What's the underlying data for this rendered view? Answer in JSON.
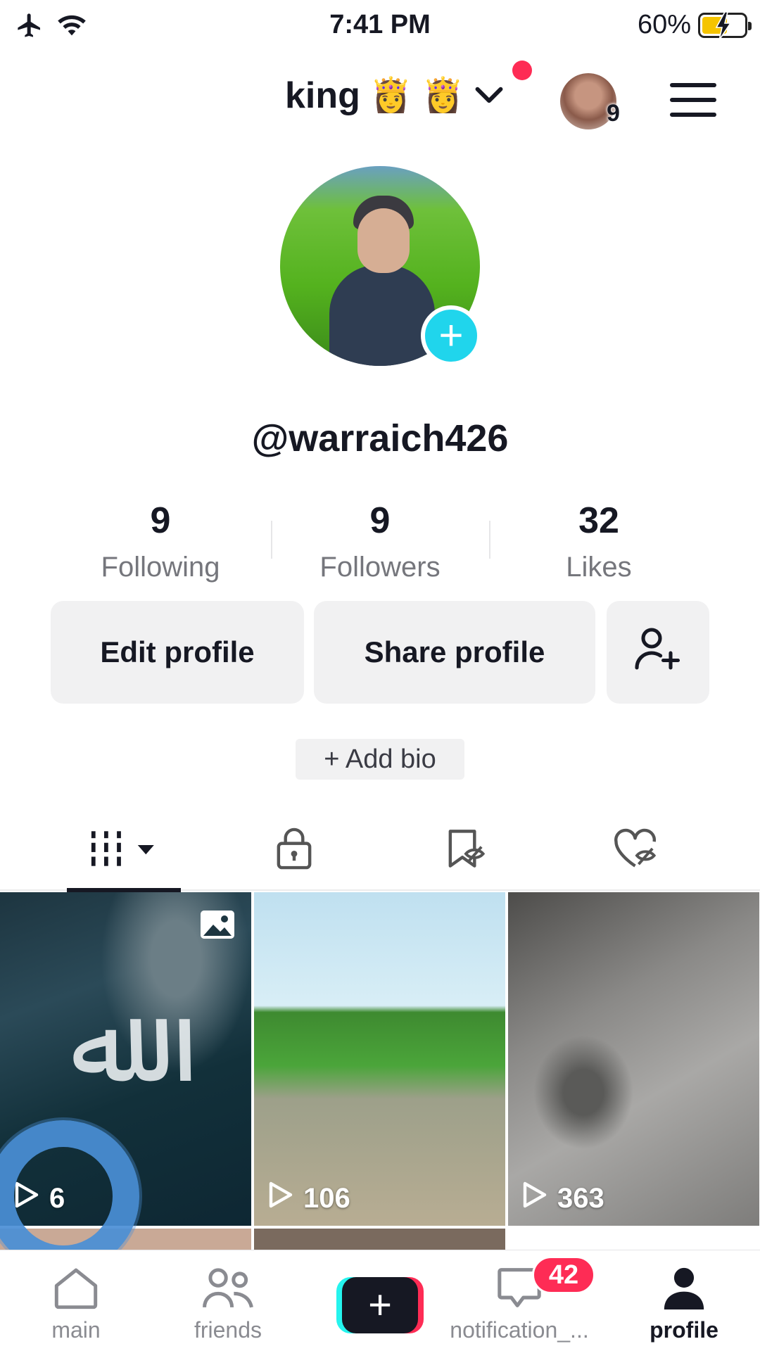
{
  "status_bar": {
    "time": "7:41 PM",
    "battery_percent": "60%",
    "battery_level": 0.6,
    "icons": [
      "airplane-icon",
      "wifi-icon",
      "battery-charging-icon"
    ]
  },
  "header": {
    "account_name": "king",
    "crowns": [
      "👸",
      "👸"
    ],
    "switcher_count": "9"
  },
  "profile": {
    "username": "@warraich426",
    "stats": [
      {
        "value": "9",
        "label": "Following"
      },
      {
        "value": "9",
        "label": "Followers"
      },
      {
        "value": "32",
        "label": "Likes"
      }
    ],
    "buttons": {
      "edit": "Edit profile",
      "share": "Share profile"
    },
    "add_bio": "+ Add bio"
  },
  "tabs": [
    {
      "name": "videos",
      "icon": "grid-bars-icon",
      "active": true
    },
    {
      "name": "private",
      "icon": "lock-icon"
    },
    {
      "name": "favorites",
      "icon": "bookmark-hidden-icon"
    },
    {
      "name": "liked",
      "icon": "heart-hidden-icon"
    }
  ],
  "videos": [
    {
      "views": "6"
    },
    {
      "views": "106"
    },
    {
      "views": "363"
    }
  ],
  "bottom_nav": {
    "items": [
      {
        "label": "main",
        "icon": "home-icon"
      },
      {
        "label": "friends",
        "icon": "friends-icon"
      },
      {
        "label": "",
        "icon": "create-plus-icon"
      },
      {
        "label": "notification_...",
        "icon": "inbox-icon"
      },
      {
        "label": "profile",
        "icon": "profile-person-icon",
        "active": true
      }
    ],
    "notification_badge": "42"
  },
  "colors": {
    "accent_cyan": "#20d5ec",
    "accent_red": "#fe2c55",
    "text_primary": "#161823",
    "text_secondary": "#75767c"
  }
}
